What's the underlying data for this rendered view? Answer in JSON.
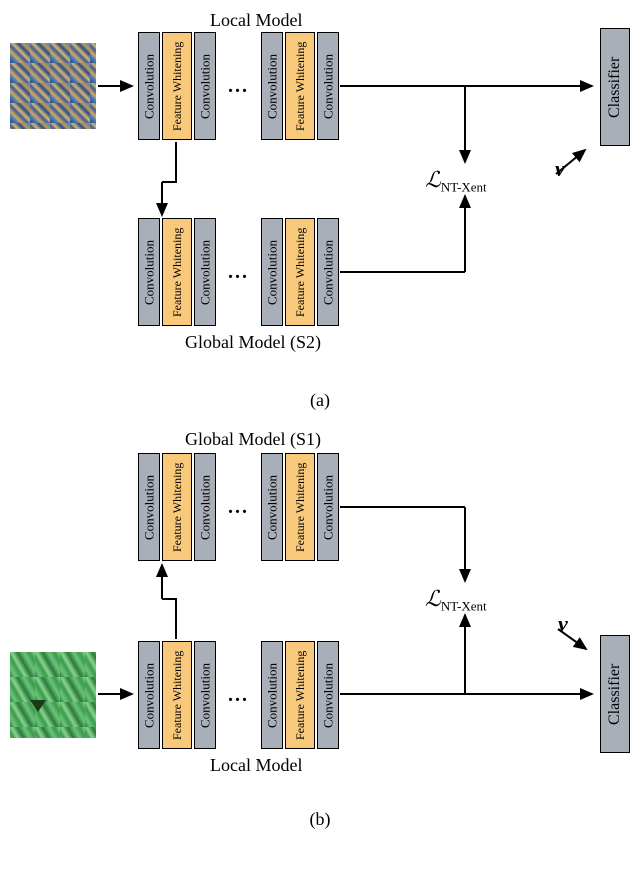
{
  "diagram_a": {
    "top_title": "Local Model",
    "bottom_title": "Global Model (S2)",
    "caption": "(a)",
    "blocks": {
      "conv": "Convolution",
      "feat": "Feature Whitening",
      "classifier": "Classifier"
    },
    "loss": {
      "symbol": "ℒ",
      "sub": "NT-Xent"
    },
    "v": "v",
    "dots": "..."
  },
  "diagram_b": {
    "top_title": "Global Model (S1)",
    "bottom_title": "Local Model",
    "caption": "(b)",
    "blocks": {
      "conv": "Convolution",
      "feat": "Feature Whitening",
      "classifier": "Classifier"
    },
    "loss": {
      "symbol": "ℒ",
      "sub": "NT-Xent"
    },
    "v": "v",
    "dots": "..."
  }
}
